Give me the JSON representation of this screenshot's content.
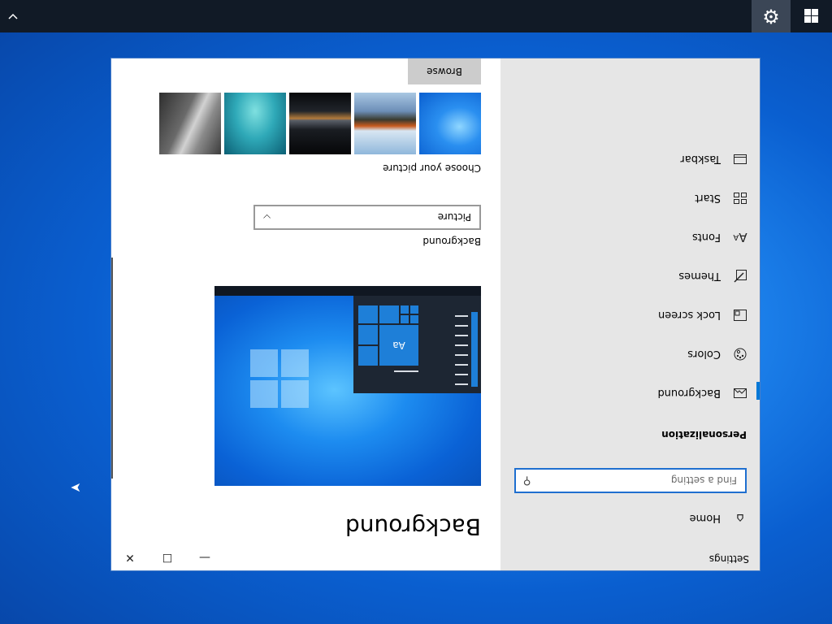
{
  "taskbar": {
    "settings_icon": "gear-icon",
    "start_icon": "windows-logo-icon",
    "chevron_icon": "chevron-down-icon"
  },
  "window": {
    "app_title": "Settings",
    "caption": {
      "minimize": "—",
      "maximize": "☐",
      "close": "✕"
    },
    "sidebar": {
      "home_label": "Home",
      "search_placeholder": "Find a setting",
      "section_title": "Personalization",
      "items": [
        {
          "label": "Background",
          "icon": "picture-icon",
          "selected": true
        },
        {
          "label": "Colors",
          "icon": "palette-icon"
        },
        {
          "label": "Lock screen",
          "icon": "lock-screen-icon"
        },
        {
          "label": "Themes",
          "icon": "themes-icon"
        },
        {
          "label": "Fonts",
          "icon": "fonts-icon"
        },
        {
          "label": "Start",
          "icon": "start-icon"
        },
        {
          "label": "Taskbar",
          "icon": "taskbar-icon"
        }
      ]
    },
    "content": {
      "page_title": "Background",
      "preview": {
        "tile_label": "Aa"
      },
      "background_label": "Background",
      "background_value": "Picture",
      "choose_label": "Choose your picture",
      "browse_label": "Browse"
    }
  },
  "colors": {
    "accent": "#0078d7",
    "sidebar_bg": "#e6e6e6",
    "taskbar_bg": "#111a26"
  }
}
